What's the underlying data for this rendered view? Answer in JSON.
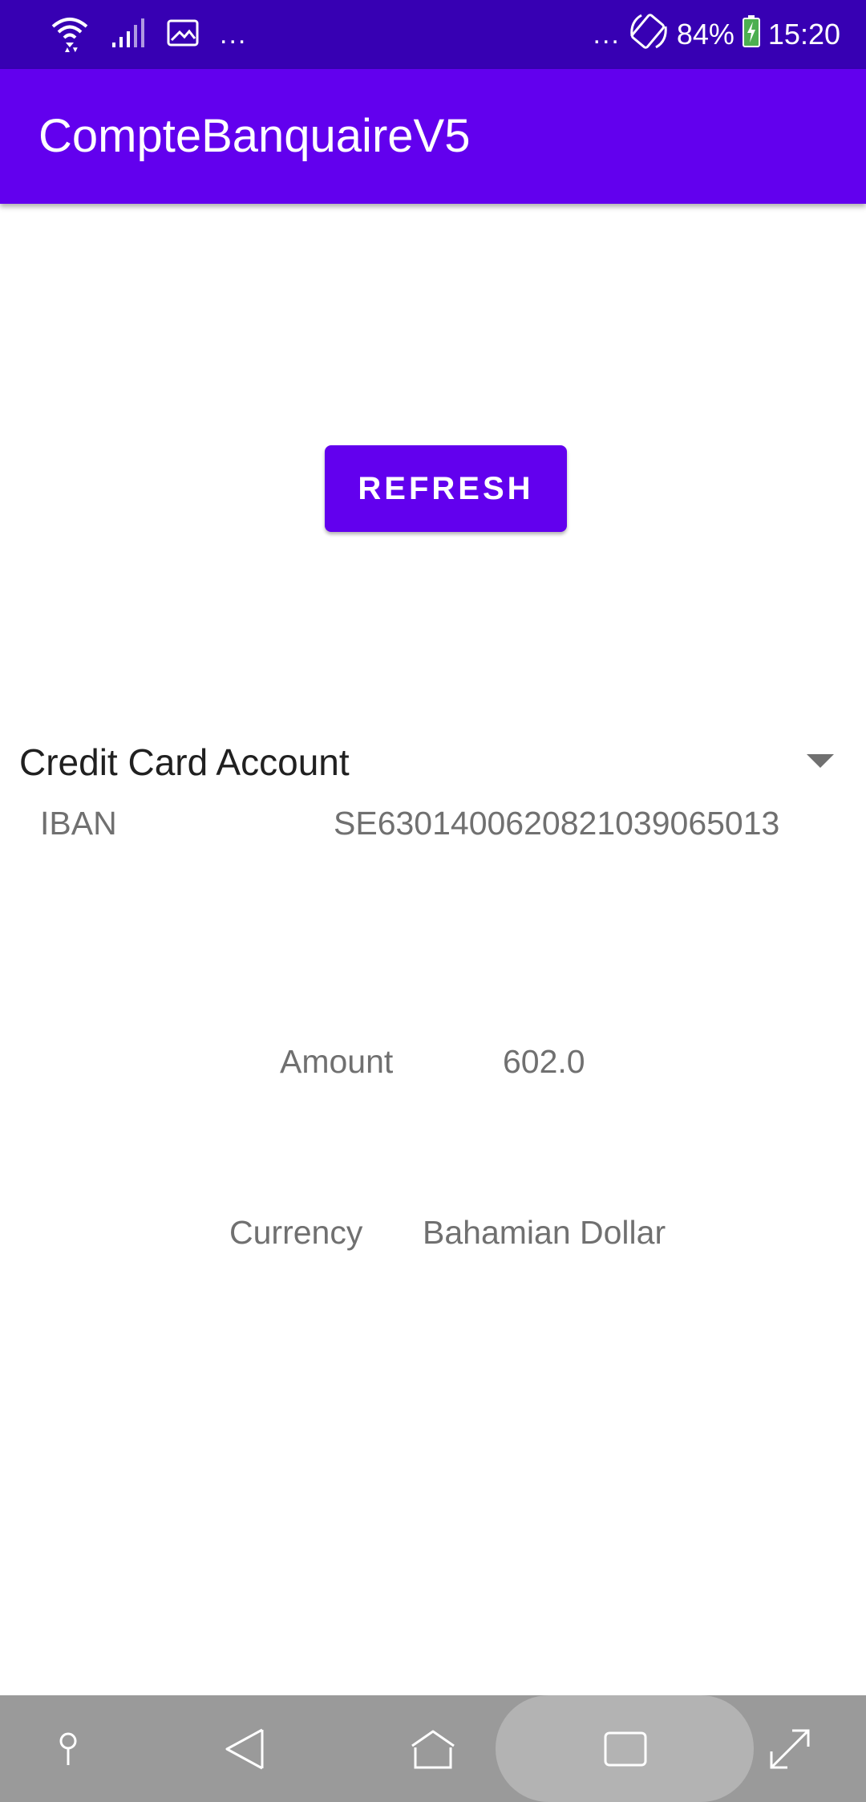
{
  "status_bar": {
    "left_dots": "...",
    "right_dots": "...",
    "battery": "84%",
    "time": "15:20",
    "icons": [
      "wifi-icon",
      "signal-icon",
      "image-icon",
      "rotate-icon",
      "battery-icon"
    ]
  },
  "app_bar": {
    "title": "CompteBanquaireV5"
  },
  "refresh_button": {
    "label": "REFRESH"
  },
  "account_spinner": {
    "selected": "Credit Card Account"
  },
  "details": {
    "iban_label": "IBAN",
    "iban_value": "SE6301400620821039065013",
    "amount_label": "Amount",
    "amount_value": "602.0",
    "currency_label": "Currency",
    "currency_value": "Bahamian Dollar"
  },
  "nav_bar": {
    "icons": [
      "pin-icon",
      "back-icon",
      "home-icon",
      "recents-icon",
      "expand-icon"
    ]
  },
  "colors": {
    "primary": "#6200EE",
    "primary_dark": "#3700B3",
    "nav_bar": "#9a9a9a"
  }
}
